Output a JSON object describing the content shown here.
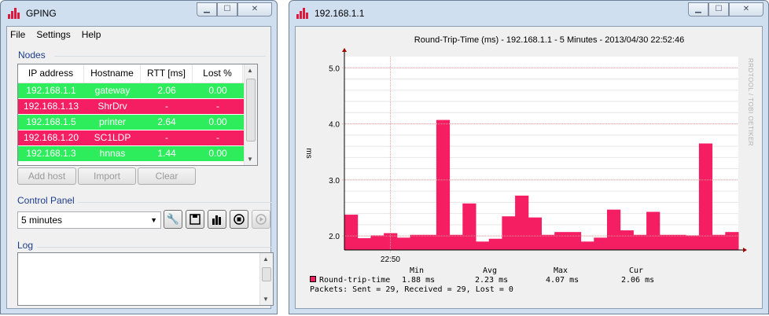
{
  "left_window": {
    "title": "GPING",
    "menu": [
      "File",
      "Settings",
      "Help"
    ],
    "nodes_title": "Nodes",
    "columns": [
      "IP address",
      "Hostname",
      "RTT [ms]",
      "Lost %"
    ],
    "rows": [
      {
        "ip": "192.168.1.1",
        "host": "gateway",
        "rtt": "2.06",
        "lost": "0.00",
        "status": "up"
      },
      {
        "ip": "192.168.1.13",
        "host": "ShrDrv",
        "rtt": "-",
        "lost": "-",
        "status": "down"
      },
      {
        "ip": "192.168.1.5",
        "host": "printer",
        "rtt": "2.64",
        "lost": "0.00",
        "status": "up"
      },
      {
        "ip": "192.168.1.20",
        "host": "SC1LDP",
        "rtt": "-",
        "lost": "-",
        "status": "down"
      },
      {
        "ip": "192.168.1.3",
        "host": "hnnas",
        "rtt": "1.44",
        "lost": "0.00",
        "status": "up"
      }
    ],
    "buttons": {
      "add_host": "Add host",
      "import": "Import",
      "clear": "Clear"
    },
    "control_title": "Control Panel",
    "interval": "5 minutes",
    "log_title": "Log",
    "colors": {
      "up": "#2ded5c",
      "down": "#f51e62"
    }
  },
  "right_window": {
    "title": "192.168.1.1",
    "side_text": "RRDTOOL / TOBI OETIKER",
    "stats": {
      "headers": [
        "Min",
        "Avg",
        "Max",
        "Cur"
      ],
      "legend": "Round-trip-time",
      "values": [
        "1.88 ms",
        "2.23 ms",
        "4.07 ms",
        "2.06 ms"
      ],
      "packets": "Packets: Sent = 29, Received = 29, Lost = 0"
    }
  },
  "chart_data": {
    "type": "area",
    "title": "Round-Trip-Time (ms) - 192.168.1.1 - 5 Minutes - 2013/04/30 22:52:46",
    "ylabel": "ms",
    "ylim": [
      1.75,
      5.2
    ],
    "yticks": [
      "5.0",
      "4.0",
      "3.0",
      "2.0"
    ],
    "ytick_values": [
      5.0,
      4.0,
      3.0,
      2.0
    ],
    "xtick_label": "22:50",
    "xtick_index": 3,
    "color": "#f51e62",
    "values": [
      2.38,
      1.96,
      2.01,
      2.05,
      1.97,
      2.02,
      2.02,
      4.07,
      2.02,
      2.58,
      1.9,
      1.95,
      2.35,
      2.72,
      2.33,
      2.02,
      2.07,
      2.07,
      1.9,
      1.97,
      2.47,
      2.1,
      2.02,
      2.43,
      2.02,
      2.02,
      2.01,
      3.65,
      2.02,
      2.07
    ]
  }
}
